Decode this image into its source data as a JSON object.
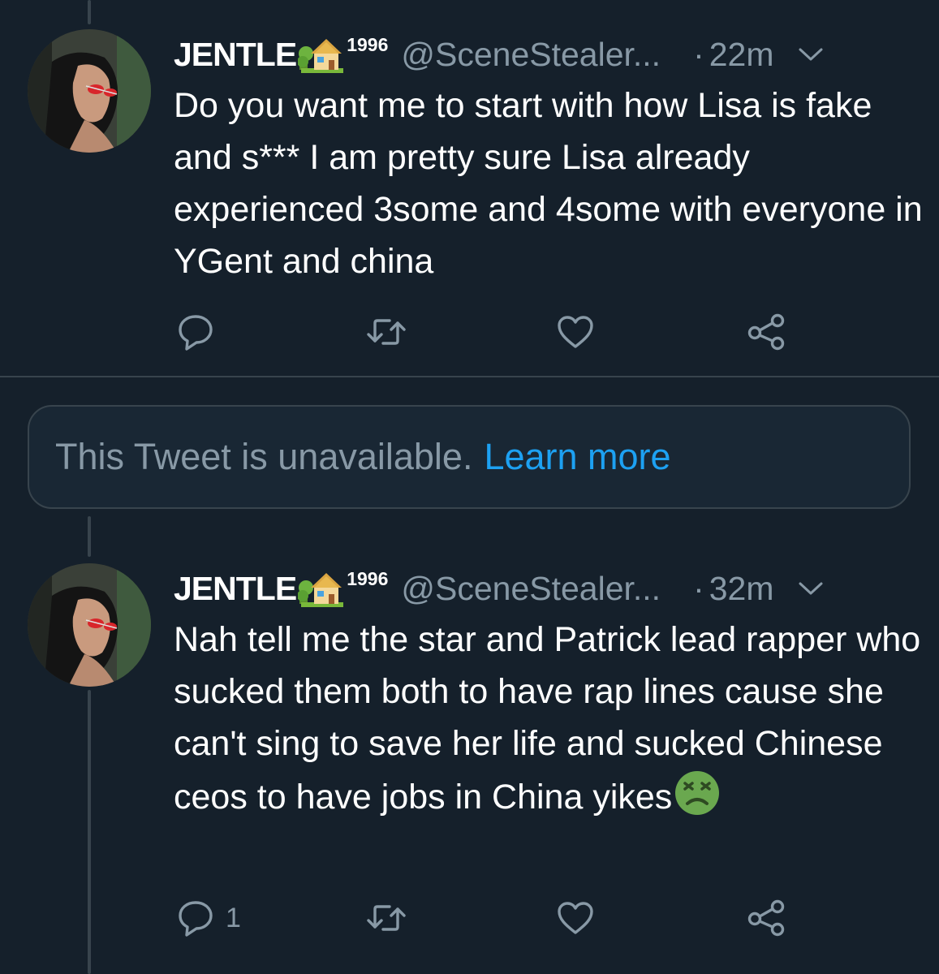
{
  "tweets": [
    {
      "display_name": "JENTLE",
      "name_emoji": "house-with-garden-icon",
      "name_suffix": "1996",
      "handle": "@SceneStealer...",
      "separator": "·",
      "time": "22m",
      "text": "Do you want me to start with how Lisa is fake and s*** I am pretty sure Lisa already experienced 3some and 4some with everyone in YGent and china",
      "reply_count": "",
      "retweet_count": "",
      "like_count": ""
    },
    {
      "display_name": "JENTLE",
      "name_emoji": "house-with-garden-icon",
      "name_suffix": "1996",
      "handle": "@SceneStealer...",
      "separator": "·",
      "time": "32m",
      "text": "Nah tell me the star and Patrick lead rapper who sucked them both to have rap lines cause she can't sing to save her life and sucked Chinese ceos to have jobs in China yikes",
      "trailing_emoji": "nauseated-face-icon",
      "reply_count": "1",
      "retweet_count": "",
      "like_count": ""
    }
  ],
  "unavailable_notice": {
    "text": "This Tweet is unavailable.",
    "link": "Learn more"
  },
  "colors": {
    "background": "#15202b",
    "secondary_text": "#8899a6",
    "link": "#1da1f2",
    "divider": "#38444d"
  }
}
